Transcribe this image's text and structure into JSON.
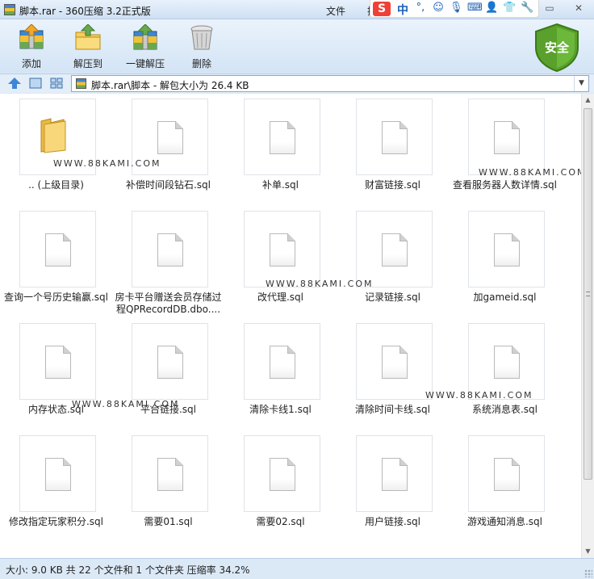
{
  "window": {
    "title": "脚本.rar - 360压缩 3.2正式版",
    "menu": {
      "file": "文件",
      "truncated": "操"
    },
    "buttons": {
      "minimize": "▭",
      "close": "✕"
    }
  },
  "ime": {
    "logo": "S",
    "lang": "中",
    "icons": [
      "punct-icon",
      "emoji-icon",
      "mic-icon",
      "keyboard-icon",
      "person-icon",
      "shirt-icon",
      "wrench-icon"
    ]
  },
  "toolbar": {
    "items": [
      {
        "label": "添加",
        "icon": "add-archive-icon"
      },
      {
        "label": "解压到",
        "icon": "extract-to-icon"
      },
      {
        "label": "一键解压",
        "icon": "one-click-extract-icon"
      },
      {
        "label": "删除",
        "icon": "delete-icon"
      }
    ],
    "security_badge": "安全"
  },
  "nav": {
    "path": "脚本.rar\\脚本 - 解包大小为 26.4 KB"
  },
  "files": [
    {
      "name": ".. (上级目录)",
      "type": "folder"
    },
    {
      "name": "补偿时间段钻石.sql",
      "type": "sql"
    },
    {
      "name": "补单.sql",
      "type": "sql"
    },
    {
      "name": "财富链接.sql",
      "type": "sql"
    },
    {
      "name": "查看服务器人数详情.sql",
      "type": "sql"
    },
    {
      "name": "查询一个号历史输赢.sql",
      "type": "sql"
    },
    {
      "name": "房卡平台赠送会员存储过程QPRecordDB.dbo....",
      "type": "sql"
    },
    {
      "name": "改代理.sql",
      "type": "sql"
    },
    {
      "name": "记录链接.sql",
      "type": "sql"
    },
    {
      "name": "加gameid.sql",
      "type": "sql"
    },
    {
      "name": "内存状态.sql",
      "type": "sql"
    },
    {
      "name": "平台链接.sql",
      "type": "sql"
    },
    {
      "name": "清除卡线1.sql",
      "type": "sql"
    },
    {
      "name": "清除时间卡线.sql",
      "type": "sql"
    },
    {
      "name": "系统消息表.sql",
      "type": "sql"
    },
    {
      "name": "修改指定玩家积分.sql",
      "type": "sql"
    },
    {
      "name": "需要01.sql",
      "type": "sql"
    },
    {
      "name": "需要02.sql",
      "type": "sql"
    },
    {
      "name": "用户链接.sql",
      "type": "sql"
    },
    {
      "name": "游戏通知消息.sql",
      "type": "sql"
    }
  ],
  "watermark": "WWW.88KAMI.COM",
  "status": "大小: 9.0 KB 共 22 个文件和 1 个文件夹 压缩率 34.2%",
  "colors": {
    "accent": "#3d86d6",
    "shield": "#5aa02c",
    "ime_red": "#ef4136"
  }
}
